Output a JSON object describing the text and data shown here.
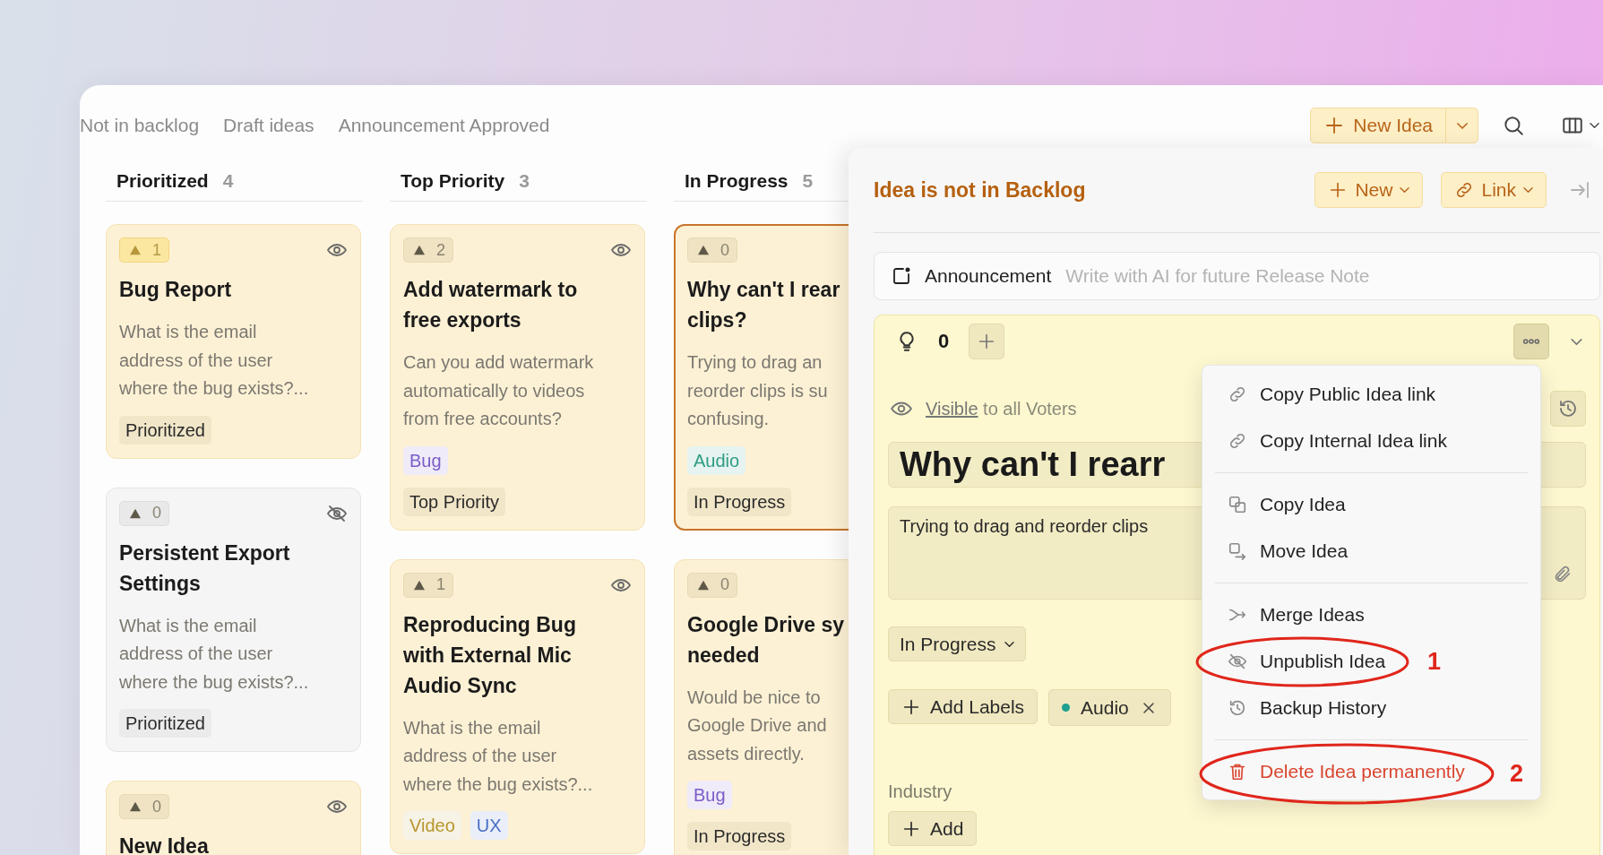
{
  "toolbar": {
    "filters": [
      {
        "label": "Not in backlog"
      },
      {
        "label": "Draft ideas"
      },
      {
        "label": "Announcement Approved"
      }
    ],
    "new_idea_button": "New Idea"
  },
  "columns": [
    {
      "title": "Prioritized",
      "count": "4",
      "cards": [
        {
          "votes": "1",
          "voted": true,
          "published": true,
          "selected": false,
          "title": "Bug Report",
          "description": "What is the email\naddress of the user\nwhere the bug exists?...",
          "status": "Prioritized"
        },
        {
          "votes": "0",
          "voted": false,
          "published": false,
          "selected": false,
          "title": "Persistent Export\nSettings",
          "description": "What is the email\naddress of the user\nwhere the bug exists?...",
          "status": "Prioritized"
        },
        {
          "votes": "0",
          "voted": false,
          "published": true,
          "selected": false,
          "title": "New Idea"
        }
      ]
    },
    {
      "title": "Top Priority",
      "count": "3",
      "cards": [
        {
          "votes": "2",
          "voted": false,
          "published": true,
          "selected": false,
          "title": "Add watermark to\nfree exports",
          "description": "Can you add watermark\nautomatically to videos\nfrom free accounts?",
          "labels": [
            {
              "name": "Bug",
              "color": "#7b5cc8"
            }
          ],
          "status": "Top Priority"
        },
        {
          "votes": "1",
          "voted": false,
          "published": true,
          "selected": false,
          "title": "Reproducing Bug\nwith External Mic\nAudio Sync",
          "description": "What is the email\naddress of the user\nwhere the bug exists?...",
          "labels": [
            {
              "name": "Video",
              "color": "#b8952c"
            },
            {
              "name": "UX",
              "color": "#4a6fc8"
            }
          ]
        }
      ]
    },
    {
      "title": "In Progress",
      "count": "5",
      "cards": [
        {
          "votes": "0",
          "voted": false,
          "selected": true,
          "title": "Why can't I rear\nclips?",
          "description": "Trying to drag an\nreorder clips is su\nconfusing.",
          "labels": [
            {
              "name": "Audio",
              "color": "#2e9c84"
            }
          ],
          "status": "In Progress"
        },
        {
          "votes": "0",
          "voted": false,
          "selected": false,
          "title": "Google Drive sy\nneeded",
          "description": "Would be nice to\nGoogle Drive and\nassets directly.",
          "labels": [
            {
              "name": "Bug",
              "color": "#7b5cc8"
            }
          ],
          "status": "In Progress"
        }
      ]
    }
  ],
  "panel": {
    "title": "Idea is not in Backlog",
    "buttons": [
      {
        "kind": "new",
        "label": "New"
      },
      {
        "kind": "link",
        "label": "Link"
      }
    ],
    "announcement": {
      "label": "Announcement",
      "placeholder": "Write with AI for future Release Note"
    },
    "idea": {
      "votes": "0",
      "visibility_link": "Visible",
      "visibility_text": " to all Voters",
      "title": "Why can't I rearr",
      "description": "Trying to drag and reorder clips",
      "status": "In Progress",
      "add_labels": "Add Labels",
      "labels": [
        {
          "name": "Audio",
          "color": "#1fa08f"
        }
      ],
      "fields": [
        {
          "label": "Industry",
          "button": "Add"
        }
      ]
    },
    "menu": {
      "open": true,
      "groups": [
        [
          {
            "kind": "link",
            "label": "Copy Public Idea link"
          },
          {
            "kind": "link",
            "label": "Copy Internal Idea link"
          }
        ],
        [
          {
            "kind": "copy",
            "label": "Copy Idea"
          },
          {
            "kind": "move",
            "label": "Move Idea"
          }
        ],
        [
          {
            "kind": "merge",
            "label": "Merge Ideas"
          },
          {
            "kind": "unpublish",
            "label": "Unpublish Idea",
            "callout": "1"
          },
          {
            "kind": "history",
            "label": "Backup History"
          }
        ],
        [
          {
            "kind": "delete",
            "label": "Delete Idea permanently",
            "callout": "2"
          }
        ]
      ]
    }
  }
}
